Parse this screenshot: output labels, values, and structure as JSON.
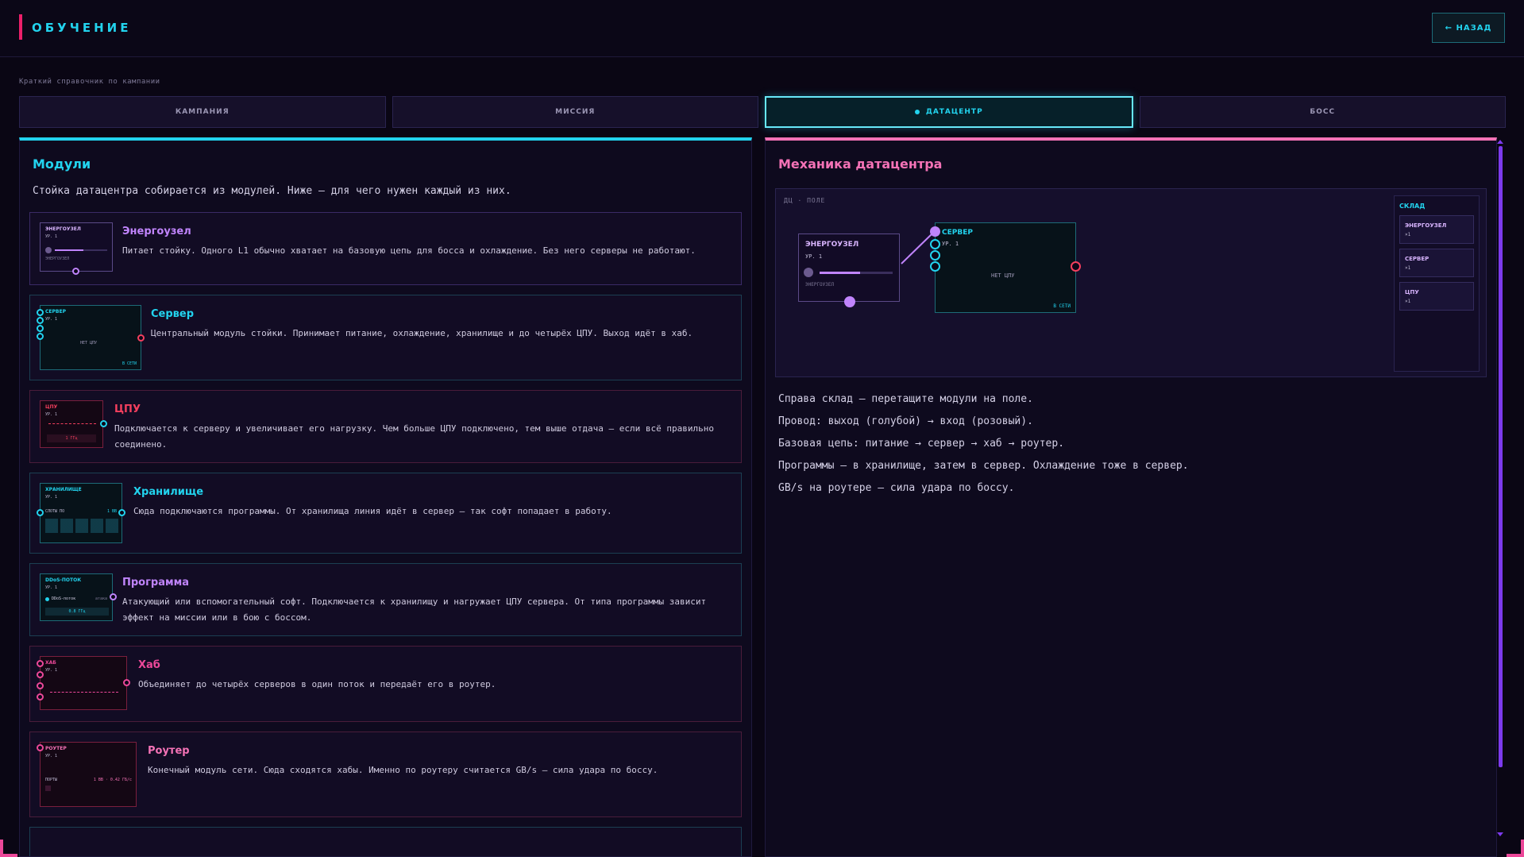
{
  "header": {
    "title": "ОБУЧЕНИЕ",
    "back_label": "← НАЗАД"
  },
  "subtitle": "Краткий справочник по кампании",
  "tabs": [
    {
      "label": "КАМПАНИЯ",
      "active": false
    },
    {
      "label": "МИССИЯ",
      "active": false
    },
    {
      "label": "ДАТАЦЕНТР",
      "active": true
    },
    {
      "label": "БОСС",
      "active": false
    }
  ],
  "modules": {
    "title": "Модули",
    "intro": "Стойка датацентра собирается из модулей. Ниже — для чего нужен каждый из них.",
    "items": [
      {
        "name": "Энергоузел",
        "desc": "Питает стойку. Одного L1 обычно хватает на базовую цепь для босса и охлаждение. Без него серверы не работают.",
        "color": "#c084fc",
        "thumb": {
          "title": "ЭНЕРГОУЗЕЛ",
          "level": "УР. 1",
          "sub": "ЭНЕРГОУЗЕЛ"
        }
      },
      {
        "name": "Сервер",
        "desc": "Центральный модуль стойки. Принимает питание, охлаждение, хранилище и до четырёх ЦПУ. Выход идёт в хаб.",
        "color": "#22d3ee",
        "thumb": {
          "title": "СЕРВЕР",
          "level": "УР. 1",
          "center": "НЕТ ЦПУ",
          "status": "В СЕТИ"
        }
      },
      {
        "name": "ЦПУ",
        "desc": "Подключается к серверу и увеличивает его нагрузку. Чем больше ЦПУ подключено, тем выше отдача — если всё правильно соединено.",
        "color": "#f43f5e",
        "thumb": {
          "title": "ЦПУ",
          "level": "УР. 1",
          "value": "1 ГГц"
        }
      },
      {
        "name": "Хранилище",
        "desc": "Сюда подключаются программы. От хранилища линия идёт в сервер — так софт попадает в работу.",
        "color": "#22d3ee",
        "thumb": {
          "title": "ХРАНИЛИЩЕ",
          "level": "УР. 1",
          "slots": "СЛОТЫ ПО",
          "count": "1 ВВ"
        }
      },
      {
        "name": "Программа",
        "desc": "Атакующий или вспомогательный софт. Подключается к хранилищу и нагружает ЦПУ сервера. От типа программы зависит эффект на миссии или в бою с боссом.",
        "color": "#c084fc",
        "thumb": {
          "title": "DDoS-ПОТОК",
          "level": "УР. 1",
          "row": "DDoS-поток",
          "tag": "атака",
          "value": "0.8 ГГц"
        }
      },
      {
        "name": "Хаб",
        "desc": "Объединяет до четырёх серверов в один поток и передаёт его в роутер.",
        "color": "#ec4899",
        "thumb": {
          "title": "ХАБ",
          "level": "УР. 1"
        }
      },
      {
        "name": "Роутер",
        "desc": "Конечный модуль сети. Сюда сходятся хабы. Именно по роутеру считается GB/s — сила удара по боссу.",
        "color": "#f472b6",
        "thumb": {
          "title": "РОУТЕР",
          "level": "УР. 1",
          "ports": "ПОРТЫ",
          "rate": "1 ВВ · 0.42 ГБ/с"
        }
      }
    ]
  },
  "mechanics": {
    "title": "Механика датацентра",
    "field_label": "ДЦ · ПОЛЕ",
    "node_power": {
      "title": "ЭНЕРГОУЗЕЛ",
      "level": "УР. 1",
      "sub": "ЭНЕРГОУЗЕЛ",
      "fill": 0.55
    },
    "node_server": {
      "title": "СЕРВЕР",
      "level": "УР. 1",
      "center": "НЕТ ЦПУ",
      "status": "В СЕТИ"
    },
    "store": {
      "title": "СКЛАД",
      "items": [
        {
          "name": "ЭНЕРГОУЗЕЛ",
          "count": "×1"
        },
        {
          "name": "СЕРВЕР",
          "count": "×1"
        },
        {
          "name": "ЦПУ",
          "count": "×1"
        }
      ]
    },
    "tips": [
      "Справа склад — перетащите модули на поле.",
      "Провод: выход (голубой) → вход (розовый).",
      "Базовая цепь: питание → сервер → хаб → роутер.",
      "Программы — в хранилище, затем в сервер. Охлаждение тоже в сервер.",
      "GB/s на роутере — сила удара по боссу."
    ]
  },
  "colors": {
    "cyan": "#22d3ee",
    "pink": "#ec4899",
    "violet": "#c084fc",
    "red": "#f43f5e",
    "bg": "#0a0614"
  }
}
